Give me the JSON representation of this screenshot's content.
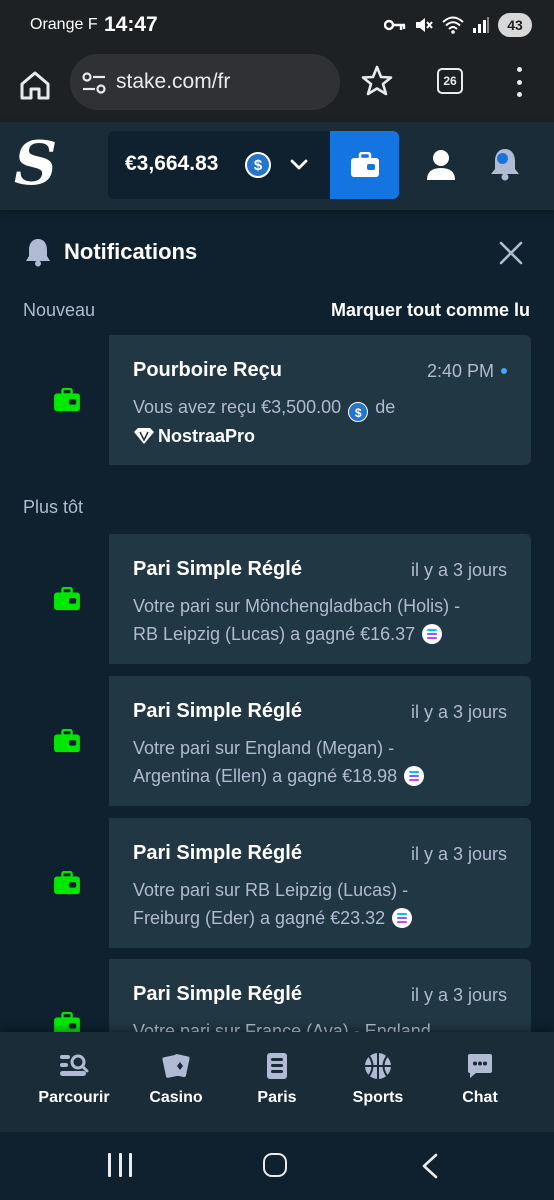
{
  "status_bar": {
    "carrier": "Orange F",
    "time": "14:47",
    "battery": "43"
  },
  "browser": {
    "url": "stake.com/fr",
    "tab_count": "26"
  },
  "header": {
    "logo": "S",
    "balance": "€3,664.83",
    "balance_currency_icon": "usdc-coin-icon",
    "colors": {
      "accent": "#1475e1",
      "background": "#0f212e",
      "panel": "#213743",
      "success": "#00e701"
    }
  },
  "notifications": {
    "title": "Notifications",
    "new_label": "Nouveau",
    "mark_all": "Marquer tout comme lu",
    "earlier_label": "Plus tôt",
    "new_items": [
      {
        "title": "Pourboire Reçu",
        "time": "2:40 PM",
        "body_prefix": "Vous avez reçu €3,500.00",
        "body_suffix": "de",
        "sender": "NostraaPro"
      }
    ],
    "earlier_items": [
      {
        "title": "Pari Simple Réglé",
        "time": "il y a 3 jours",
        "line1": "Votre pari sur Mönchengladbach (Holis) -",
        "line2": "RB Leipzig (Lucas) a gagné €16.37"
      },
      {
        "title": "Pari Simple Réglé",
        "time": "il y a 3 jours",
        "line1": "Votre pari sur England (Megan) -",
        "line2": "Argentina (Ellen) a gagné €18.98"
      },
      {
        "title": "Pari Simple Réglé",
        "time": "il y a 3 jours",
        "line1": "Votre pari sur RB Leipzig (Lucas) -",
        "line2": "Freiburg (Eder) a gagné €23.32"
      },
      {
        "title": "Pari Simple Réglé",
        "time": "il y a 3 jours",
        "line1": "Votre pari sur France (Ava) - England",
        "line2": ""
      }
    ]
  },
  "bottom_nav": [
    {
      "label": "Parcourir",
      "icon": "browse-icon"
    },
    {
      "label": "Casino",
      "icon": "cards-icon"
    },
    {
      "label": "Paris",
      "icon": "betslip-icon"
    },
    {
      "label": "Sports",
      "icon": "basketball-icon"
    },
    {
      "label": "Chat",
      "icon": "chat-icon"
    }
  ]
}
